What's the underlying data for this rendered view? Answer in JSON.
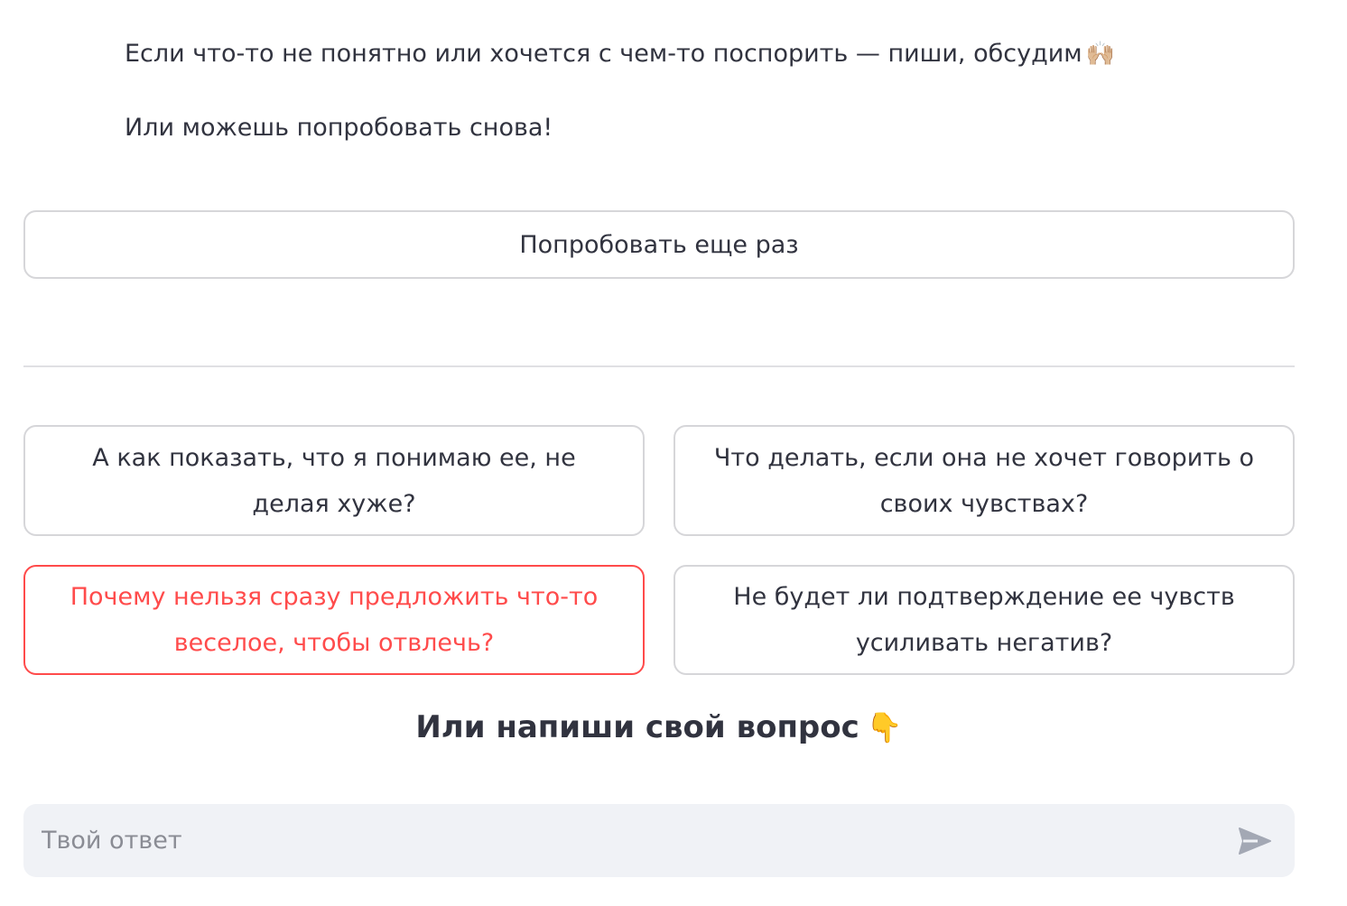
{
  "message": {
    "line1": "Если что-то не понятно или хочется с чем-то поспорить — пиши, обсудим",
    "line1_emoji": "🙌🏼",
    "line2": "Или можешь попробовать снова!"
  },
  "retry_button": {
    "label": "Попробовать еще раз"
  },
  "suggestions": [
    {
      "label": "А как показать, что я понимаю ее, не делая хуже?"
    },
    {
      "label": "Что делать, если она не хочет говорить о своих чувствах?"
    },
    {
      "label": "Почему нельзя сразу предложить что-то веселое, чтобы отвлечь?"
    },
    {
      "label": "Не будет ли подтверждение ее чувств усиливать негатив?"
    }
  ],
  "prompt": {
    "text": "Или напиши свой вопрос",
    "emoji": "👇"
  },
  "chat_input": {
    "placeholder": "Твой ответ",
    "value": ""
  },
  "colors": {
    "text": "#31333f",
    "accent": "#ff4b4b",
    "border": "#d6d6d9",
    "input_bg": "#f0f2f6",
    "placeholder": "#8a8c94"
  },
  "icons": {
    "send": "send-icon",
    "raising_hands": "raising-hands-emoji",
    "pointing_down": "pointing-down-emoji"
  }
}
